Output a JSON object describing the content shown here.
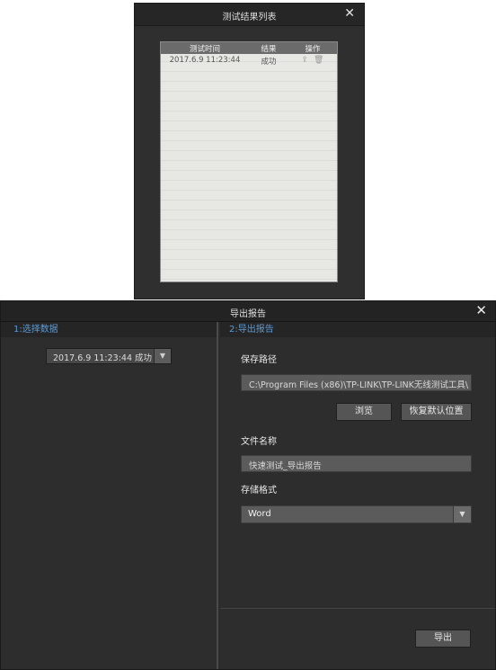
{
  "results_dialog": {
    "title": "测试结果列表",
    "close_glyph": "✕",
    "columns": {
      "time": "测试时间",
      "result": "结果",
      "action": "操作"
    },
    "rows": [
      {
        "time": "2017.6.9 11:23:44",
        "result": "成功",
        "share_glyph": "⇪",
        "delete_glyph": "🗑"
      }
    ]
  },
  "export_dialog": {
    "title": "导出报告",
    "close_glyph": "✕",
    "left": {
      "section_title": "1:选择数据",
      "selected_data": "2017.6.9 11:23:44 成功",
      "dropdown_glyph": "▼"
    },
    "right": {
      "section_title": "2:导出报告",
      "save_path_label": "保存路径",
      "save_path_value": "C:\\Program Files (x86)\\TP-LINK\\TP-LINK无线测试工具\\",
      "browse_label": "浏览",
      "restore_default_label": "恢复默认位置",
      "file_name_label": "文件名称",
      "file_name_value": "快速测试_导出报告",
      "format_label": "存储格式",
      "format_value": "Word",
      "format_dropdown_glyph": "▼",
      "export_label": "导出"
    }
  },
  "colors": {
    "accent_blue": "#5b9ad6",
    "dialog_bg": "#2b2b2b",
    "titlebar_bg": "#232323",
    "button_bg": "#555555",
    "list_bg": "#e7e7e3"
  }
}
